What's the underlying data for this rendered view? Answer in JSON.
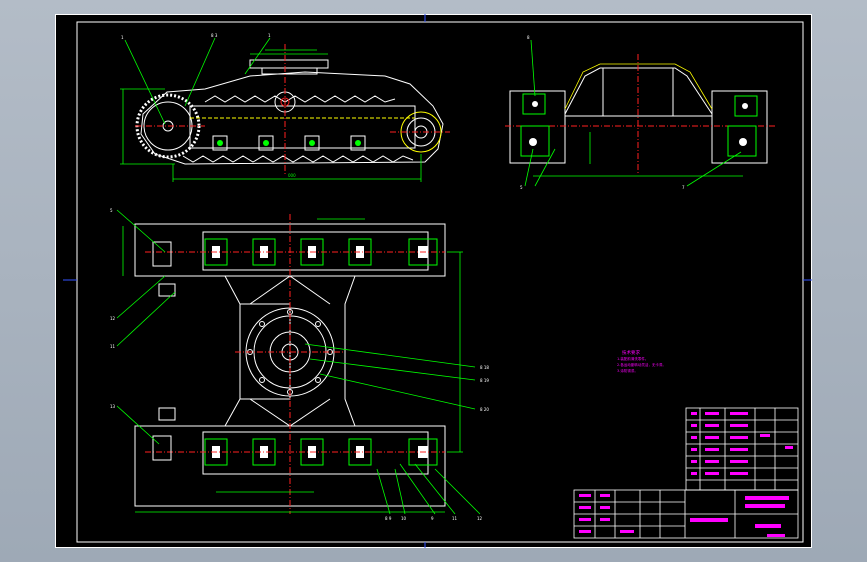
{
  "drawing": {
    "leader_labels_top": [
      "1",
      "8 3",
      "1"
    ],
    "leader_labels_side": [
      "8",
      "5",
      "7"
    ],
    "leader_labels_left": [
      "5",
      "12",
      "11",
      "13"
    ],
    "leader_labels_center": [
      "8 18",
      "8 19",
      "8 20"
    ],
    "leader_labels_bottom": [
      "8 9",
      "10",
      "9",
      "11",
      "12"
    ],
    "notes_title": "技术要求",
    "notes": [
      "1.装配前清洗零件。",
      "2.各运动副转动灵活，无卡滞。",
      "3.涂防锈漆。"
    ]
  },
  "colors": {
    "background": "#000000",
    "outline": "#ffffff",
    "dimension": "#00ff00",
    "centerline": "#ff2020",
    "title_block": "#ff00ff",
    "hidden": "#ffff00",
    "accent": "#00ffff"
  }
}
